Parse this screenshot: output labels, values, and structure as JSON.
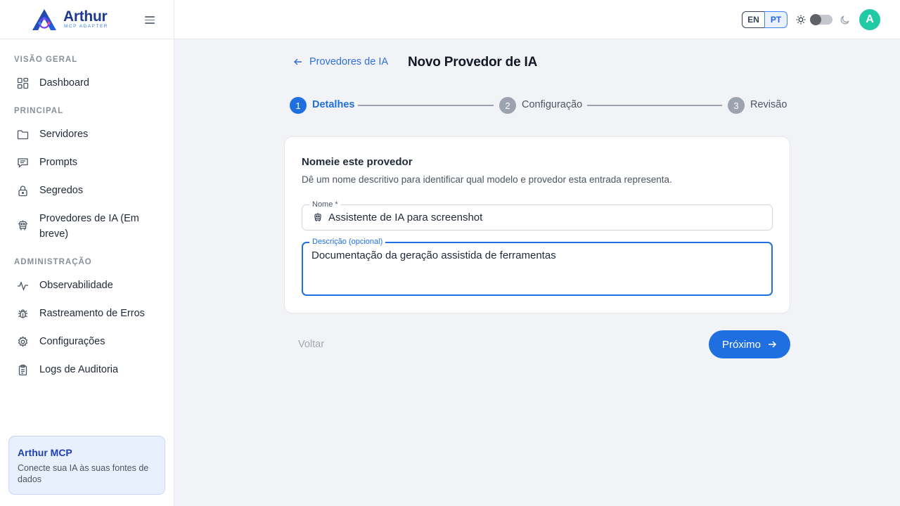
{
  "brand": {
    "name": "Arthur",
    "subtitle": "MCP ADAPTER"
  },
  "sidebar": {
    "sections": [
      {
        "label": "VISÃO GERAL"
      },
      {
        "label": "PRINCIPAL"
      },
      {
        "label": "ADMINISTRAÇÃO"
      }
    ],
    "items": [
      {
        "label": "Dashboard",
        "icon": "dashboard-icon"
      },
      {
        "label": "Servidores",
        "icon": "folder-icon"
      },
      {
        "label": "Prompts",
        "icon": "message-icon"
      },
      {
        "label": "Segredos",
        "icon": "lock-icon"
      },
      {
        "label": "Provedores de IA (Em breve)",
        "icon": "robot-icon"
      },
      {
        "label": "Observabilidade",
        "icon": "activity-icon"
      },
      {
        "label": "Rastreamento de Erros",
        "icon": "bug-icon"
      },
      {
        "label": "Configurações",
        "icon": "gear-icon"
      },
      {
        "label": "Logs de Auditoria",
        "icon": "clipboard-icon"
      }
    ],
    "promo": {
      "title": "Arthur MCP",
      "description": "Conecte sua IA às suas fontes de dados"
    }
  },
  "topbar": {
    "languages": [
      "EN",
      "PT"
    ],
    "active_language": "PT",
    "theme": "light",
    "avatar_initial": "A"
  },
  "page": {
    "back_label": "Provedores de IA",
    "title": "Novo Provedor de IA"
  },
  "stepper": {
    "steps": [
      {
        "number": "1",
        "label": "Detalhes",
        "state": "active"
      },
      {
        "number": "2",
        "label": "Configuração",
        "state": "pending"
      },
      {
        "number": "3",
        "label": "Revisão",
        "state": "pending"
      }
    ]
  },
  "form": {
    "title": "Nomeie este provedor",
    "description": "Dê um nome descritivo para identificar qual modelo e provedor esta entrada representa.",
    "name_field": {
      "label": "Nome *",
      "value": "Assistente de IA para screenshot"
    },
    "description_field": {
      "label": "Descrição (opcional)",
      "value": "Documentação da geração assistida de ferramentas"
    }
  },
  "actions": {
    "back_label": "Voltar",
    "next_label": "Próximo"
  },
  "colors": {
    "primary": "#1f6fe0",
    "avatar": "#22c9a5",
    "step_inactive": "#9ca3af"
  }
}
